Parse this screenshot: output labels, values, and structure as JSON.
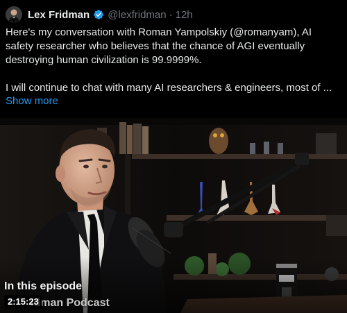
{
  "author": {
    "display_name": "Lex Fridman",
    "handle": "@lexfridman",
    "separator": "·",
    "timestamp": "12h",
    "avatar_icon": "avatar-photo",
    "verified_icon": "verified-badge-icon",
    "verified_color": "#1d9bf0"
  },
  "tweet": {
    "text": "Here's my conversation with Roman Yampolskiy (@romanyam), AI safety researcher who believes that the chance of AGI eventually destroying human civilization is 99.9999%.\n\nI will continue to chat with many AI researchers & engineers, most of ...",
    "show_more": "Show more"
  },
  "media": {
    "type": "video",
    "overlay_title": "In this episode",
    "overlay_podcast_partial": "idman Podcast",
    "duration": "2:15:23"
  },
  "colors": {
    "background": "#000000",
    "text": "#e7e9ea",
    "muted": "#71767b",
    "link": "#1d9bf0"
  }
}
